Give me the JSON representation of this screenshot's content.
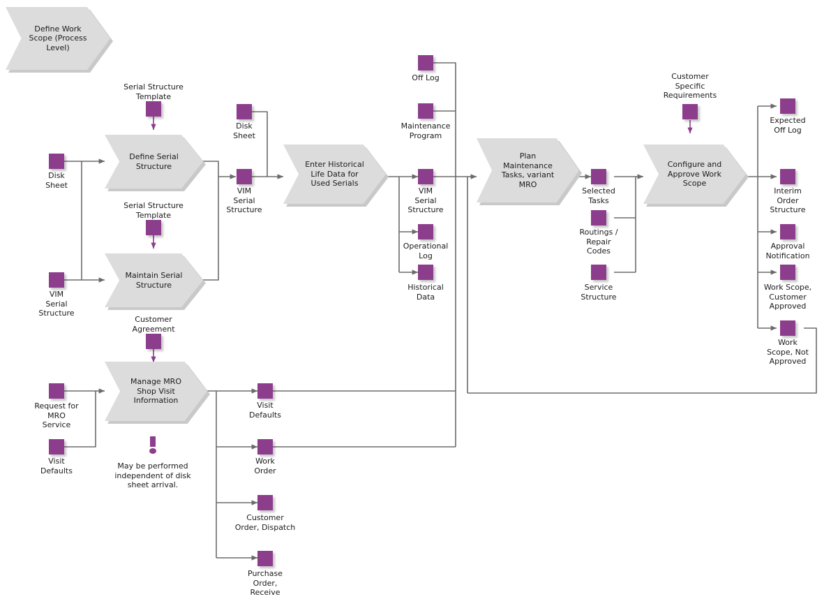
{
  "diagram": {
    "title": "Define Work Scope (Process Level)",
    "banner": {
      "label": "Define Work\nScope (Process\nLevel)"
    },
    "colors": {
      "object": "#8c3d8c",
      "process_fill": "#dcdcdc",
      "wire": "#6b6b6b",
      "text": "#1a1a1a"
    },
    "processes": [
      {
        "id": "define_serial_structure",
        "label": "Define Serial\nStructure"
      },
      {
        "id": "maintain_serial_structure",
        "label": "Maintain Serial\nStructure"
      },
      {
        "id": "enter_historical_life_data",
        "label": "Enter Historical\nLife Data for\nUsed Serials"
      },
      {
        "id": "plan_maintenance_tasks",
        "label": "Plan\nMaintenance\nTasks, variant\nMRO"
      },
      {
        "id": "configure_approve_work_scope",
        "label": "Configure and\nApprove Work\nScope"
      },
      {
        "id": "manage_mro_shop_visit",
        "label": "Manage MRO\nShop Visit\nInformation"
      }
    ],
    "objects": [
      {
        "id": "serial_structure_template_1",
        "label": "Serial Structure\nTemplate"
      },
      {
        "id": "serial_structure_template_2",
        "label": "Serial Structure\nTemplate"
      },
      {
        "id": "disk_sheet_in",
        "label": "Disk\nSheet"
      },
      {
        "id": "vim_serial_structure_in",
        "label": "VIM\nSerial\nStructure"
      },
      {
        "id": "disk_sheet_mid",
        "label": "Disk\nSheet"
      },
      {
        "id": "vim_serial_structure_mid",
        "label": "VIM\nSerial\nStructure"
      },
      {
        "id": "off_log",
        "label": "Off Log"
      },
      {
        "id": "maintenance_program",
        "label": "Maintenance\nProgram"
      },
      {
        "id": "vim_serial_structure_out",
        "label": "VIM\nSerial\nStructure"
      },
      {
        "id": "operational_log",
        "label": "Operational\nLog"
      },
      {
        "id": "historical_data",
        "label": "Historical\nData"
      },
      {
        "id": "selected_tasks",
        "label": "Selected\nTasks"
      },
      {
        "id": "routings_repair_codes",
        "label": "Routings /\nRepair\nCodes"
      },
      {
        "id": "service_structure",
        "label": "Service\nStructure"
      },
      {
        "id": "customer_specific_requirements",
        "label": "Customer\nSpecific\nRequirements"
      },
      {
        "id": "expected_off_log",
        "label": "Expected\nOff Log"
      },
      {
        "id": "interim_order_structure",
        "label": "Interim\nOrder\nStructure"
      },
      {
        "id": "approval_notification",
        "label": "Approval\nNotification"
      },
      {
        "id": "work_scope_customer_approved",
        "label": "Work Scope,\nCustomer\nApproved"
      },
      {
        "id": "work_scope_not_approved",
        "label": "Work\nScope, Not\nApproved"
      },
      {
        "id": "customer_agreement",
        "label": "Customer\nAgreement"
      },
      {
        "id": "request_for_mro_service",
        "label": "Request for\nMRO\nService"
      },
      {
        "id": "visit_defaults_in",
        "label": "Visit\nDefaults"
      },
      {
        "id": "visit_defaults_out",
        "label": "Visit\nDefaults"
      },
      {
        "id": "work_order",
        "label": "Work\nOrder"
      },
      {
        "id": "customer_order_dispatch",
        "label": "Customer\nOrder, Dispatch"
      },
      {
        "id": "purchase_order_receive",
        "label": "Purchase\nOrder,\nReceive"
      }
    ],
    "notes": [
      {
        "id": "independent_note",
        "label": "May be performed\nindependent of disk\nsheet arrival."
      }
    ]
  }
}
